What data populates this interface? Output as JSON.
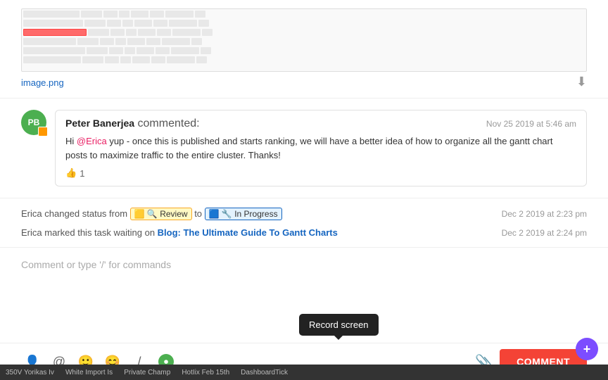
{
  "image": {
    "filename": "image.png",
    "download_label": "⬇"
  },
  "comment": {
    "avatar_initials": "PB",
    "commenter": "Peter Banerjea",
    "action": "commented:",
    "timestamp": "Nov 25 2019 at 5:46 am",
    "text_part1": "Hi ",
    "mention": "@Erica",
    "text_part2": " yup - once this is published and starts ranking, we will have a better idea of how to organize all the gantt chart posts to maximize traffic to the entire cluster. Thanks!",
    "like_count": "1"
  },
  "status_changes": [
    {
      "actor": "Erica",
      "action": "changed status from",
      "from_badge": "🟨🔍 Review",
      "to": "to",
      "to_badge": "🟦🔧 In Progress",
      "timestamp": "Dec 2 2019 at 2:23 pm"
    },
    {
      "actor": "Erica",
      "action": "marked this task waiting on",
      "link": "Blog: The Ultimate Guide To Gantt Charts",
      "timestamp": "Dec 2 2019 at 2:24 pm"
    }
  ],
  "comment_input": {
    "placeholder": "Comment or type '/' for commands"
  },
  "toolbar": {
    "icons": [
      {
        "name": "person-icon",
        "symbol": "👤"
      },
      {
        "name": "at-icon",
        "symbol": "@"
      },
      {
        "name": "emoji-smile-icon",
        "symbol": "🙂"
      },
      {
        "name": "emoji-icon",
        "symbol": "😊"
      },
      {
        "name": "slash-icon",
        "symbol": "/"
      },
      {
        "name": "record-icon",
        "symbol": "⏺"
      }
    ],
    "attach_icon": "📎",
    "comment_button": "COMMENT",
    "tooltip": "Record screen"
  },
  "taskbar": {
    "items": [
      "350V Yorikas Iv",
      "White Import Is",
      "Private Champ",
      "HotIix Feb 15th",
      "DashboardTick"
    ]
  },
  "fab": {
    "label": "+"
  }
}
